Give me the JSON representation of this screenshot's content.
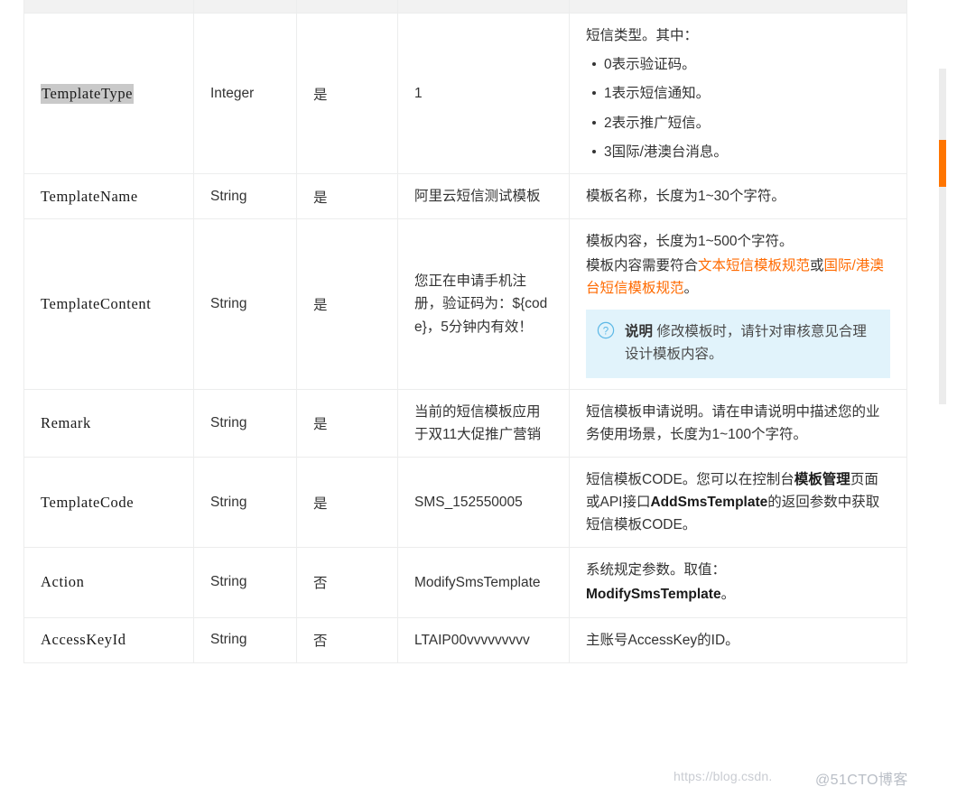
{
  "table": {
    "columns": [
      "",
      "",
      "",
      "",
      ""
    ],
    "rows": [
      {
        "name": "TemplateType",
        "name_selected": true,
        "type": "Integer",
        "required": "是",
        "example": "1",
        "desc_intro": "短信类型。其中：",
        "desc_bullets": [
          "0表示验证码。",
          "1表示短信通知。",
          "2表示推广短信。",
          "3国际/港澳台消息。"
        ]
      },
      {
        "name": "TemplateName",
        "name_selected": false,
        "type": "String",
        "required": "是",
        "example": "阿里云短信测试模板",
        "desc_intro": "模板名称，长度为1~30个字符。"
      },
      {
        "name": "TemplateContent",
        "name_selected": false,
        "type": "String",
        "required": "是",
        "example": "您正在申请手机注册，验证码为：${code}，5分钟内有效！",
        "desc_line1": "模板内容，长度为1~500个字符。",
        "desc_line2_pre": "模板内容需要符合",
        "desc_link1": "文本短信模板规范",
        "desc_line2_mid": "或",
        "desc_link2": "国际/港澳台短信模板规范",
        "desc_line2_post": "。",
        "note": {
          "icon": "question-circle-icon",
          "title": "说明",
          "text": "修改模板时，请针对审核意见合理设计模板内容。"
        }
      },
      {
        "name": "Remark",
        "name_selected": false,
        "type": "String",
        "required": "是",
        "example": "当前的短信模板应用于双11大促推广营销",
        "desc_intro": "短信模板申请说明。请在申请说明中描述您的业务使用场景，长度为1~100个字符。"
      },
      {
        "name": "TemplateCode",
        "name_selected": false,
        "type": "String",
        "required": "是",
        "example": "SMS_152550005",
        "desc_pre": "短信模板CODE。您可以在控制台",
        "desc_b1": "模板管理",
        "desc_mid": "页面或API接口",
        "desc_b2": "AddSmsTemplate",
        "desc_post": "的返回参数中获取短信模板CODE。"
      },
      {
        "name": "Action",
        "name_selected": false,
        "type": "String",
        "required": "否",
        "example": "ModifySmsTemplate",
        "desc_pre": "系统规定参数。取值：",
        "desc_b1": "ModifySmsTemplate",
        "desc_post": "。"
      },
      {
        "name": "AccessKeyId",
        "name_selected": false,
        "type": "String",
        "required": "否",
        "example": "LTAIP00vvvvvvvvv",
        "desc_intro": "主账号AccessKey的ID。"
      }
    ]
  },
  "scrollbar": {
    "orientation": "vertical",
    "thumb_color": "#ff7500",
    "track_color": "#ececec"
  },
  "watermarks": {
    "csdn": "https://blog.csdn.",
    "cto": "@51CTO博客"
  }
}
